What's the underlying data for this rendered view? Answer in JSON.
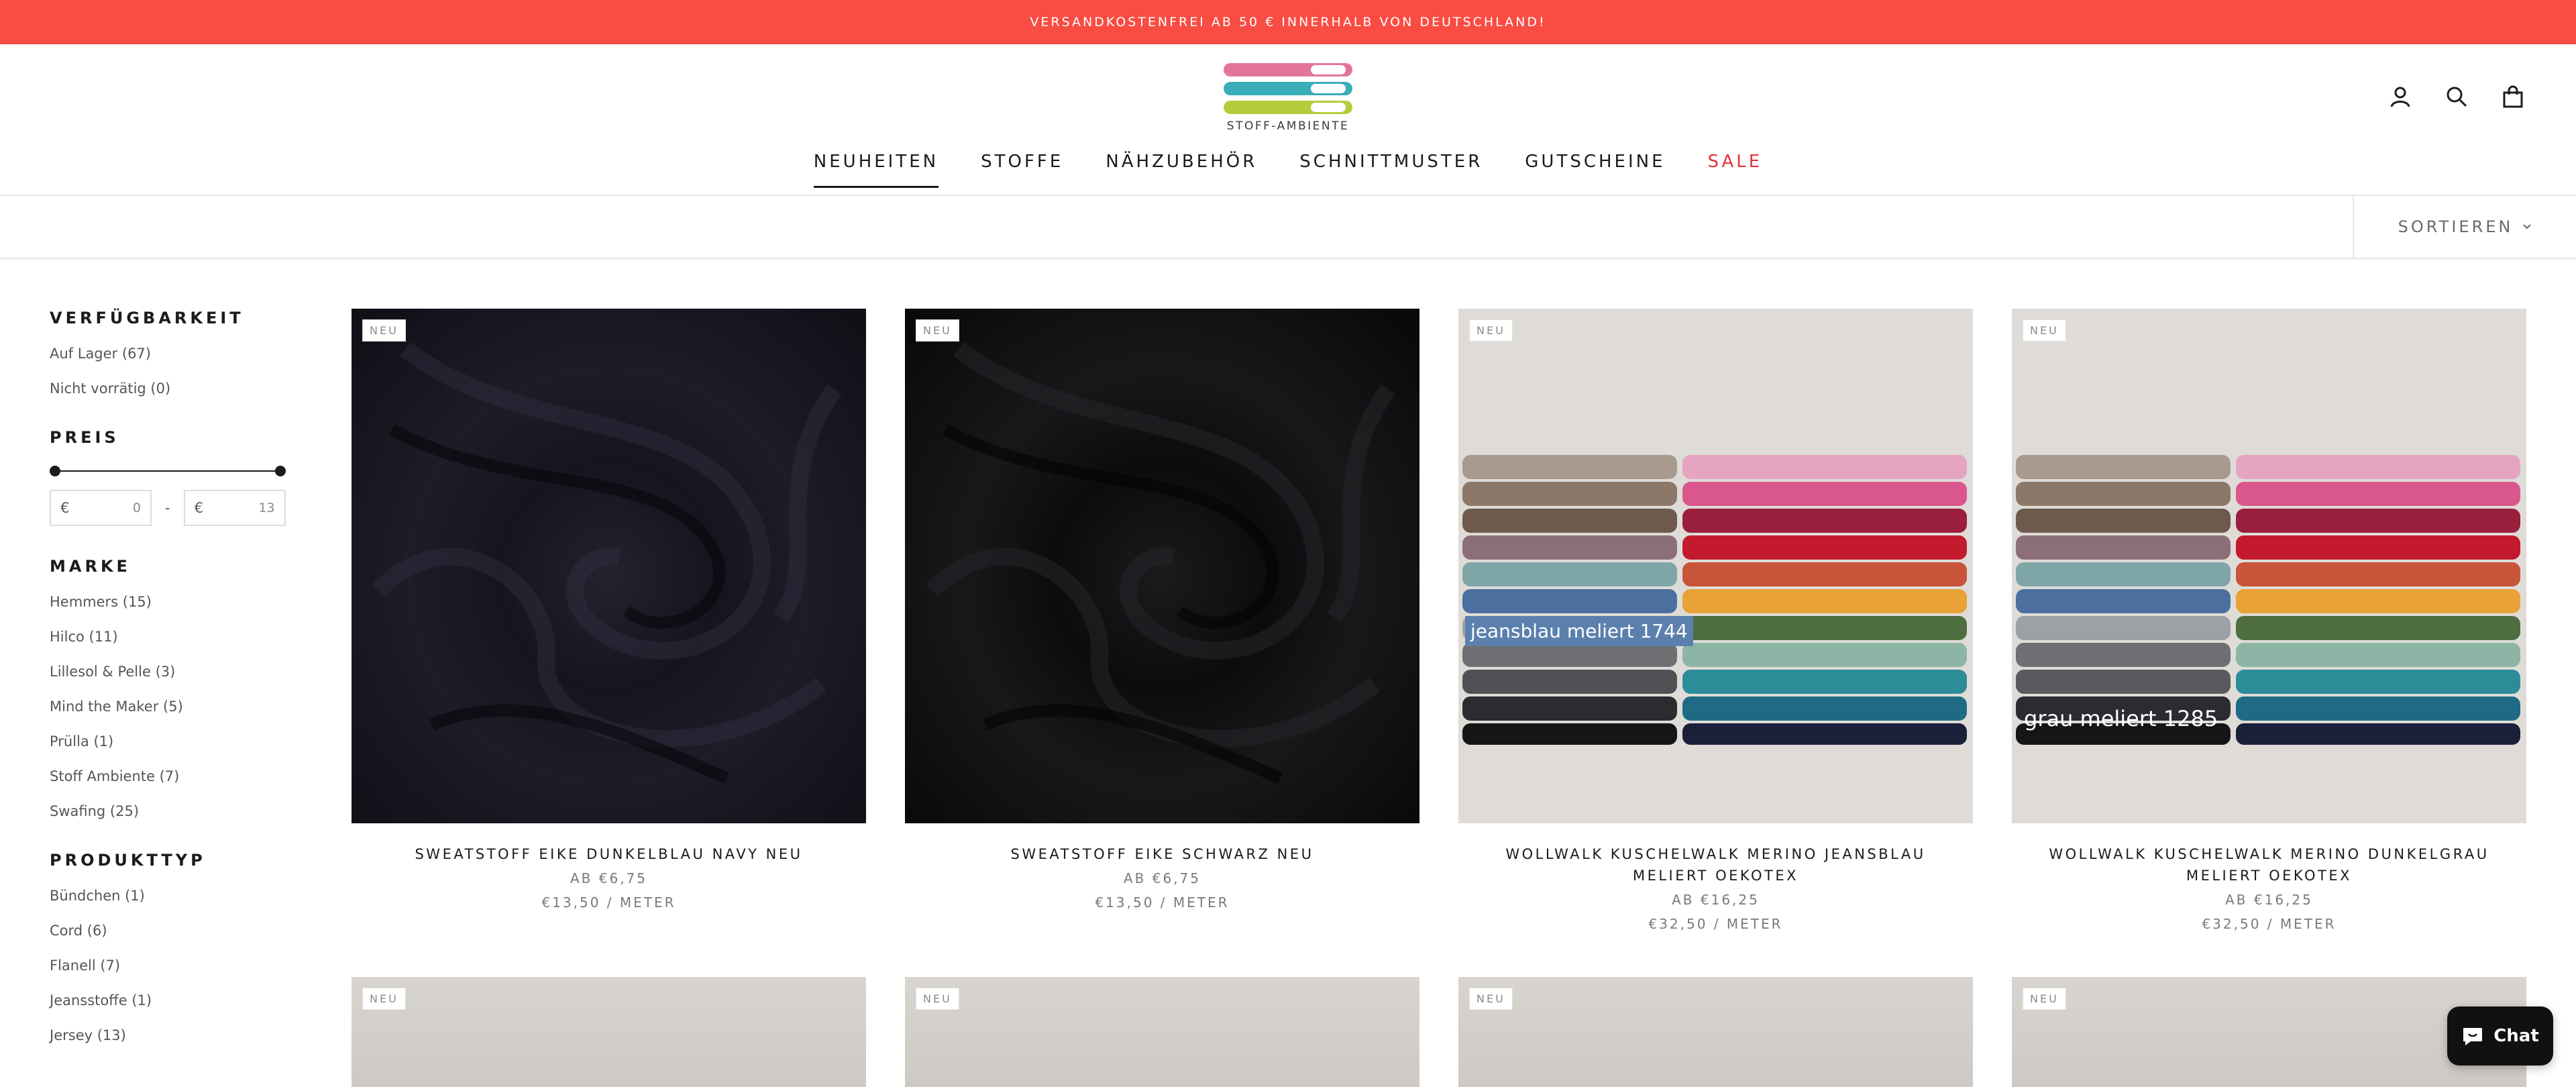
{
  "announcement": {
    "text": "VERSANDKOSTENFREI AB 50 € INNERHALB VON DEUTSCHLAND!"
  },
  "logo": {
    "text": "STOFF-AMBIENTE"
  },
  "header_icons": [
    "account-icon",
    "search-icon",
    "cart-icon"
  ],
  "nav": {
    "items": [
      {
        "label": "NEUHEITEN"
      },
      {
        "label": "STOFFE"
      },
      {
        "label": "NÄHZUBEHÖR"
      },
      {
        "label": "SCHNITTMUSTER"
      },
      {
        "label": "GUTSCHEINE"
      },
      {
        "label": "SALE"
      }
    ],
    "active": "NEUHEITEN"
  },
  "toolbar": {
    "sort_label": "SORTIEREN"
  },
  "filters": {
    "availability": {
      "title": "VERFÜGBARKEIT",
      "items": [
        "Auf Lager (67)",
        "Nicht vorrätig (0)"
      ]
    },
    "price": {
      "title": "PREIS",
      "currency": "€",
      "min": "0",
      "max": "13"
    },
    "brand": {
      "title": "MARKE",
      "items": [
        "Hemmers (15)",
        "Hilco (11)",
        "Lillesol & Pelle (3)",
        "Mind the Maker (5)",
        "Prülla (1)",
        "Stoff Ambiente (7)",
        "Swafing (25)"
      ]
    },
    "product_type": {
      "title": "PRODUKTTYP",
      "items": [
        "Bündchen (1)",
        "Cord (6)",
        "Flanell (7)",
        "Jeansstoffe (1)",
        "Jersey (13)"
      ]
    }
  },
  "products": [
    {
      "badge": "NEU",
      "title": "SWEATSTOFF EIKE DUNKELBLAU NAVY NEU",
      "price": "AB €6,75",
      "unit_price": "€13,50 / METER"
    },
    {
      "badge": "NEU",
      "title": "SWEATSTOFF EIKE SCHWARZ NEU",
      "price": "AB €6,75",
      "unit_price": "€13,50 / METER"
    },
    {
      "badge": "NEU",
      "title": "WOLLWALK KUSCHELWALK MERINO JEANSBLAU MELIERT OEKOTEX",
      "price": "AB €16,25",
      "unit_price": "€32,50 / METER",
      "image_label": "jeansblau meliert 1744"
    },
    {
      "badge": "NEU",
      "title": "WOLLWALK KUSCHELWALK MERINO DUNKELGRAU MELIERT OEKOTEX",
      "price": "AB €16,25",
      "unit_price": "€32,50 / METER",
      "image_label": "grau meliert 1285"
    },
    {
      "badge": "NEU"
    },
    {
      "badge": "NEU"
    },
    {
      "badge": "NEU"
    },
    {
      "badge": "NEU"
    }
  ],
  "chat": {
    "label": "Chat"
  },
  "colors": {
    "announcement_bg": "#f94c43",
    "sale": "#e0333a",
    "text": "#1c1b1b"
  }
}
